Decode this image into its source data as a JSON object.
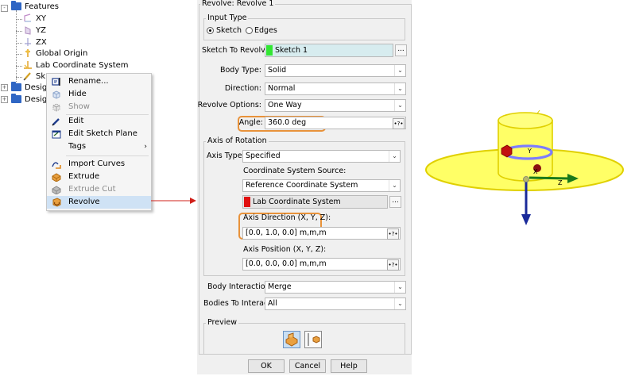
{
  "tree": {
    "root_label": "Features",
    "items": [
      {
        "label": "XY",
        "icon": "plane-icon"
      },
      {
        "label": "YZ",
        "icon": "plane-icon"
      },
      {
        "label": "ZX",
        "icon": "plane-icon"
      },
      {
        "label": "Global Origin",
        "icon": "origin-icon"
      },
      {
        "label": "Lab Coordinate System",
        "icon": "coordinate-system-icon"
      },
      {
        "label": "Sk",
        "icon": "sketch-icon"
      }
    ],
    "design_items": [
      {
        "label": "Desig"
      },
      {
        "label": "Desig"
      }
    ]
  },
  "context_menu": {
    "items": [
      {
        "label": "Rename...",
        "icon": "rename-icon",
        "enabled": true
      },
      {
        "label": "Hide",
        "icon": "hide-icon",
        "enabled": true
      },
      {
        "label": "Show",
        "icon": "show-icon",
        "enabled": false
      },
      {
        "label": "Edit",
        "icon": "pencil-icon",
        "enabled": true
      },
      {
        "label": "Edit Sketch Plane",
        "icon": "sketch-plane-icon",
        "enabled": true
      },
      {
        "label": "Tags",
        "icon": "",
        "enabled": true,
        "submenu_arrow": "›"
      },
      {
        "label": "Import Curves",
        "icon": "import-curves-icon",
        "enabled": true
      },
      {
        "label": "Extrude",
        "icon": "extrude-icon",
        "enabled": true
      },
      {
        "label": "Extrude Cut",
        "icon": "extrude-cut-icon",
        "enabled": false
      },
      {
        "label": "Revolve",
        "icon": "revolve-icon",
        "enabled": true,
        "highlighted": true
      }
    ]
  },
  "dialog": {
    "title": "Revolve: Revolve 1",
    "input_type": {
      "title": "Input Type",
      "options": [
        {
          "label": "Sketch",
          "selected": true
        },
        {
          "label": "Edges",
          "selected": false
        }
      ]
    },
    "sketch_to_revolve": {
      "label": "Sketch To Revolve:",
      "value": "Sketch 1",
      "swatch_color": "#33e633"
    },
    "body_type": {
      "label": "Body Type:",
      "value": "Solid"
    },
    "direction": {
      "label": "Direction:",
      "value": "Normal"
    },
    "revolve_options": {
      "label": "Revolve Options:",
      "value": "One Way"
    },
    "angle": {
      "label": "Angle:",
      "value": "360.0 deg",
      "spin": "•?•"
    },
    "axis_of_rotation": {
      "title": "Axis of Rotation",
      "axis_type": {
        "label": "Axis Type:",
        "value": "Specified"
      },
      "cs_source": {
        "label": "Coordinate System Source:",
        "value": "Reference Coordinate System"
      },
      "cs": {
        "value": "Lab Coordinate System",
        "swatch_color": "#e01010"
      },
      "axis_direction": {
        "label": "Axis Direction (X, Y, Z):",
        "value": "[0.0, 1.0, 0.0] m,m,m",
        "spin": "•?•"
      },
      "axis_position": {
        "label": "Axis Position (X, Y, Z):",
        "value": "[0.0, 0.0, 0.0] m,m,m",
        "spin": "•?•"
      }
    },
    "body_interaction": {
      "label": "Body Interaction",
      "value": "Merge"
    },
    "bodies_to_interact": {
      "label": "Bodies To Interact",
      "value": "All"
    },
    "preview": {
      "title": "Preview"
    },
    "buttons": {
      "ok": "OK",
      "cancel": "Cancel",
      "help": "Help"
    },
    "dots": "...",
    "dropdown_glyph": "⌄"
  },
  "viewport": {
    "axis_labels": {
      "x": "X",
      "y": "Y",
      "z": "Z"
    },
    "colors": {
      "body": "#ffff66",
      "body_edge": "#e0d000",
      "x_axis": "#c21010",
      "y_axis": "#1a7a1a",
      "z_axis": "#1a2a9a",
      "ring": "#7d7dff"
    }
  },
  "colors": {
    "highlight": "#cfe2f5",
    "orange": "#e8923a",
    "arrow": "#d0201a"
  }
}
